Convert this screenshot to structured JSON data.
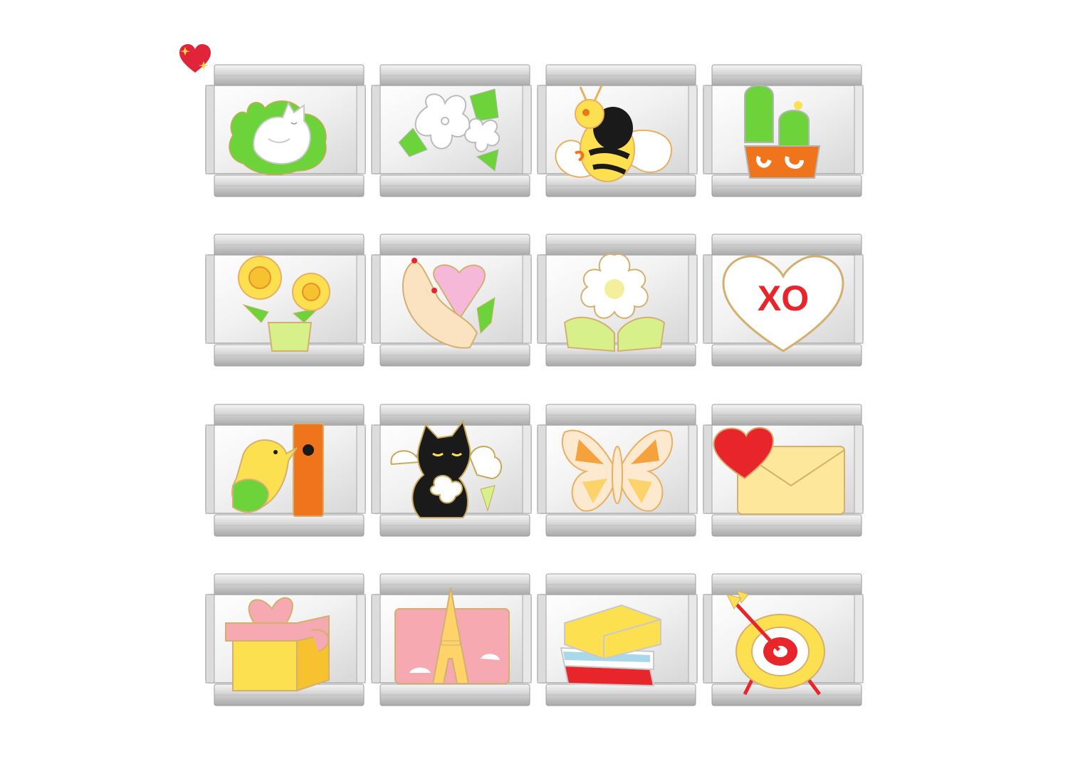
{
  "badge": {
    "icon": "sparkling-heart-icon",
    "color": "#e0243a"
  },
  "charms": [
    {
      "id": "cat-on-leaf",
      "icon": "sleeping-cat-icon"
    },
    {
      "id": "white-flowers",
      "icon": "jasmine-flower-icon"
    },
    {
      "id": "bee",
      "icon": "bee-icon"
    },
    {
      "id": "cactus",
      "icon": "potted-cactus-icon"
    },
    {
      "id": "sunflowers",
      "icon": "sunflower-pot-icon"
    },
    {
      "id": "hand-heart",
      "icon": "hand-holding-heart-icon"
    },
    {
      "id": "daisy",
      "icon": "daisy-icon"
    },
    {
      "id": "xo-heart",
      "icon": "xo-heart-icon",
      "text": "XO"
    },
    {
      "id": "bird-house",
      "icon": "bird-birdhouse-icon"
    },
    {
      "id": "black-cat",
      "icon": "black-cat-flowers-icon"
    },
    {
      "id": "butterfly",
      "icon": "butterfly-icon"
    },
    {
      "id": "love-letter",
      "icon": "heart-envelope-icon"
    },
    {
      "id": "gift",
      "icon": "gift-box-icon"
    },
    {
      "id": "eiffel",
      "icon": "eiffel-tower-icon"
    },
    {
      "id": "books",
      "icon": "book-stack-icon"
    },
    {
      "id": "target",
      "icon": "target-arrow-icon"
    }
  ],
  "colors": {
    "silver": "#d9d9d9",
    "red": "#e8252b",
    "yellow": "#fde050",
    "green": "#6cd33a",
    "orange": "#f0741c",
    "pink": "#f6a9b0"
  }
}
